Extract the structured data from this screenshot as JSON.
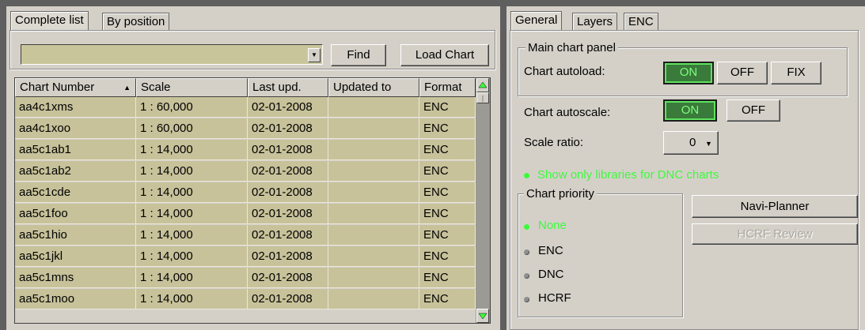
{
  "left_panel": {
    "tabs": [
      "Complete list",
      "By position"
    ],
    "search": {
      "value": "",
      "find_label": "Find"
    },
    "load_chart_label": "Load Chart",
    "table": {
      "columns": [
        "Chart Number",
        "Scale",
        "Last upd.",
        "Updated to",
        "Format"
      ],
      "sort_column": "Chart Number",
      "sort_direction": "ascending",
      "rows": [
        [
          "aa4c1xms",
          "1 : 60,000",
          "02-01-2008",
          "",
          "ENC"
        ],
        [
          "aa4c1xoo",
          "1 : 60,000",
          "02-01-2008",
          "",
          "ENC"
        ],
        [
          "aa5c1ab1",
          "1 : 14,000",
          "02-01-2008",
          "",
          "ENC"
        ],
        [
          "aa5c1ab2",
          "1 : 14,000",
          "02-01-2008",
          "",
          "ENC"
        ],
        [
          "aa5c1cde",
          "1 : 14,000",
          "02-01-2008",
          "",
          "ENC"
        ],
        [
          "aa5c1foo",
          "1 : 14,000",
          "02-01-2008",
          "",
          "ENC"
        ],
        [
          "aa5c1hio",
          "1 : 14,000",
          "02-01-2008",
          "",
          "ENC"
        ],
        [
          "aa5c1jkl",
          "1 : 14,000",
          "02-01-2008",
          "",
          "ENC"
        ],
        [
          "aa5c1mns",
          "1 : 14,000",
          "02-01-2008",
          "",
          "ENC"
        ],
        [
          "aa5c1moo",
          "1 : 14,000",
          "02-01-2008",
          "",
          "ENC"
        ]
      ]
    }
  },
  "right_panel": {
    "tabs": [
      "General",
      "Layers",
      "ENC"
    ],
    "main_chart_panel": {
      "title": "Main chart panel",
      "autoload_label": "Chart autoload:",
      "autoload_options": [
        "ON",
        "OFF",
        "FIX"
      ],
      "autoload_selected": "ON"
    },
    "autoscale": {
      "label": "Chart autoscale:",
      "options": [
        "ON",
        "OFF"
      ],
      "selected": "ON"
    },
    "scale_ratio": {
      "label": "Scale ratio:",
      "value": "0"
    },
    "dnc_libraries_label": "Show only libraries for DNC charts",
    "chart_priority": {
      "title": "Chart priority",
      "options": [
        "None",
        "ENC",
        "DNC",
        "HCRF"
      ],
      "selected": "None"
    },
    "navi_planner_label": "Navi-Planner",
    "hcrf_review_label": "HCRF Review"
  },
  "colors": {
    "panel": "#d4d0c8",
    "cell": "#c7c29a",
    "active_green": "#3dfa3d",
    "toggle_on_bg": "#3a7a3a"
  }
}
